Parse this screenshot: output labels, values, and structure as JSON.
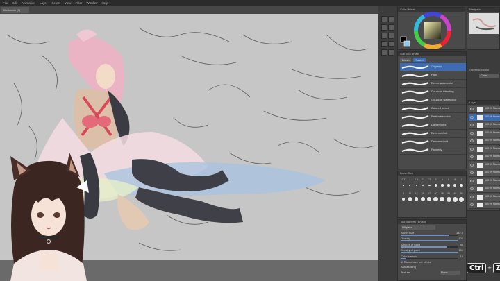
{
  "menu": [
    "File",
    "Edit",
    "Animation",
    "Layer",
    "Select",
    "View",
    "Filter",
    "Window",
    "Help"
  ],
  "document_tab": "Illustration (0)",
  "colors": {
    "canvas_bg": "#c6c6c6",
    "panel_bg": "#4a4a4a",
    "accent": "#6f8fbf",
    "main_color": "#000000",
    "sub_color": "#8ec9ec"
  },
  "panels": {
    "color_wheel": "Color Wheel",
    "navigator": "Navigator",
    "sub_tool": "Sub Tool Brush",
    "brush_size": "Brush Size",
    "tool_property": "Tool property (Brush)",
    "layer": "Layer"
  },
  "sub_tool_tabs": [
    "Brush",
    "Pastel"
  ],
  "brushes": [
    {
      "label": "Oil paint"
    },
    {
      "label": "Paint"
    },
    {
      "label": "Dense watercolor"
    },
    {
      "label": "Gouache blending"
    },
    {
      "label": "Gouache watercolor"
    },
    {
      "label": "Colored pencil"
    },
    {
      "label": "Real watercolor"
    },
    {
      "label": "Darker lines"
    },
    {
      "label": "Deformed oil"
    },
    {
      "label": "Deformed old"
    },
    {
      "label": "Painterly"
    }
  ],
  "brush_sizes": [
    "0.7",
    "1",
    "1.5",
    "2",
    "2.5",
    "3",
    "4",
    "5",
    "6",
    "7",
    "8",
    "10",
    "12",
    "15",
    "17",
    "20",
    "25",
    "30",
    "40",
    "50"
  ],
  "tool_property": {
    "tool_name": "Oil paint",
    "rows": [
      {
        "label": "Brush Size",
        "value": "142.0",
        "fraction": 0.85
      },
      {
        "label": "Opacity",
        "value": "100",
        "fraction": 1.0
      },
      {
        "label": "Amount of paint",
        "value": "80",
        "fraction": 0.8
      },
      {
        "label": "Density of paint",
        "value": "100",
        "fraction": 1.0
      },
      {
        "label": "Color stretch",
        "value": "10",
        "fraction": 0.1
      }
    ],
    "checkbox_label": "Randomize per stroke",
    "anti_alias_label": "Anti-aliasing",
    "texture_label": "Texture",
    "texture_value": "None"
  },
  "layers": [
    "100 % Normal",
    "100 % Normal Layer 11",
    "100 % Normal Layer 10",
    "100 % Normal Layer 9",
    "100 % Normal Layer 8",
    "100 % Normal Layer 7",
    "100 % Normal Layer 6",
    "100 % Normal Layer 5",
    "100 % Normal Layer 4",
    "100 % Normal Layer 3",
    "100 % Normal Layer 2",
    "100 % Normal Layer 1",
    "100 % Normal Paper"
  ],
  "expression_color_label": "Expression color",
  "expression_color_value": "Color",
  "shortcut": {
    "key1": "Ctrl",
    "plus": "+",
    "key2": "Z"
  }
}
